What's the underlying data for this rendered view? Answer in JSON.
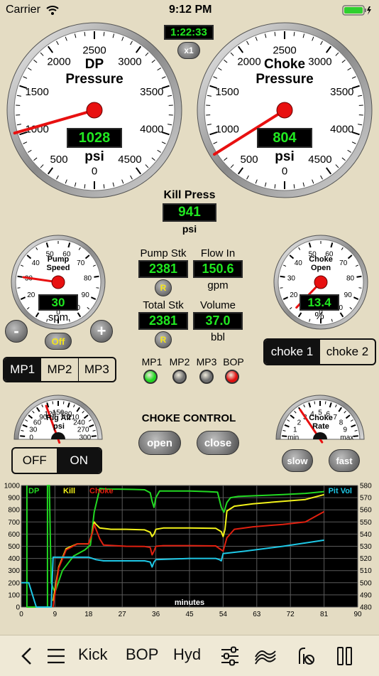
{
  "status_bar": {
    "carrier": "Carrier",
    "time": "9:12 PM"
  },
  "timer": {
    "elapsed": "1:22:33",
    "speed": "x1"
  },
  "gauges": {
    "dp": {
      "title_line1": "DP",
      "title_line2": "Pressure",
      "value": "1028",
      "unit": "psi",
      "ticks": [
        "0",
        "500",
        "1000",
        "1500",
        "2000",
        "2500",
        "3000",
        "3500",
        "4000",
        "4500"
      ],
      "needle_value": 1028,
      "max": 5000
    },
    "choke": {
      "title_line1": "Choke",
      "title_line2": "Pressure",
      "value": "804",
      "unit": "psi",
      "ticks": [
        "0",
        "500",
        "1000",
        "1500",
        "2000",
        "2500",
        "3000",
        "3500",
        "4000",
        "4500"
      ],
      "needle_value": 804,
      "max": 5000
    },
    "pump_speed": {
      "title_line1": "Pump",
      "title_line2": "Speed",
      "value": "30",
      "unit": "spm",
      "ticks": [
        "0",
        "10",
        "20",
        "30",
        "40",
        "50",
        "60",
        "70",
        "80",
        "90",
        "100"
      ],
      "needle_value": 30,
      "max": 110
    },
    "choke_open": {
      "title_line1": "Choke",
      "title_line2": "Open",
      "value": "13.4",
      "unit": "%",
      "ticks": [
        "0",
        "10",
        "20",
        "30",
        "40",
        "50",
        "60",
        "70",
        "80",
        "90",
        "100"
      ],
      "needle_value": 13.4,
      "max": 110
    },
    "rig_air": {
      "title_line1": "Rig Air",
      "title_line2": "psi",
      "ticks": [
        "0",
        "30",
        "60",
        "90",
        "120",
        "150",
        "180",
        "210",
        "240",
        "270",
        "300"
      ],
      "needle_value": 115,
      "max": 300
    },
    "choke_rate": {
      "title_line1": "Choke",
      "title_line2": "Rate",
      "ticks": [
        "min",
        "1",
        "2",
        "3",
        "4",
        "5",
        "6",
        "7",
        "8",
        "9",
        "max"
      ],
      "needle_value": 3,
      "max": 10
    }
  },
  "kill_press": {
    "label": "Kill Press",
    "value": "941",
    "unit": "psi"
  },
  "pump_stk": {
    "label": "Pump Stk",
    "value": "2381",
    "reset": "R"
  },
  "flow_in": {
    "label": "Flow In",
    "value": "150.6",
    "unit": "gpm"
  },
  "total_stk": {
    "label": "Total Stk",
    "value": "2381",
    "reset": "R"
  },
  "volume": {
    "label": "Volume",
    "value": "37.0",
    "unit": "bbl"
  },
  "pump_controls": {
    "minus": "-",
    "plus": "+",
    "off": "Off"
  },
  "pump_select": {
    "items": [
      "MP1",
      "MP2",
      "MP3"
    ],
    "selected": "MP1"
  },
  "choke_select": {
    "items": [
      "choke 1",
      "choke 2"
    ],
    "selected": "choke 1"
  },
  "indicators": [
    {
      "label": "MP1",
      "color": "#22d822"
    },
    {
      "label": "MP2",
      "color": "#707070"
    },
    {
      "label": "MP3",
      "color": "#707070"
    },
    {
      "label": "BOP",
      "color": "#e01010"
    }
  ],
  "choke_control": {
    "title": "CHOKE CONTROL",
    "open": "open",
    "close": "close",
    "slow": "slow",
    "fast": "fast"
  },
  "air_toggle": {
    "items": [
      "OFF",
      "ON"
    ],
    "selected": "ON"
  },
  "toolbar": {
    "kick": "Kick",
    "bop": "BOP",
    "hyd": "Hyd"
  },
  "chart_data": {
    "type": "line",
    "xlabel": "minutes",
    "x_ticks": [
      0,
      9,
      18,
      27,
      36,
      45,
      54,
      63,
      72,
      81,
      90
    ],
    "y_left_ticks": [
      0,
      100,
      200,
      300,
      400,
      500,
      600,
      700,
      800,
      900,
      1000
    ],
    "y_right_ticks": [
      480,
      490,
      500,
      510,
      520,
      530,
      540,
      550,
      560,
      570,
      580
    ],
    "xlim": [
      0,
      90
    ],
    "ylim_left": [
      0,
      1000
    ],
    "ylim_right": [
      480,
      580
    ],
    "grid": true,
    "series": [
      {
        "name": "DP",
        "color": "#22d822",
        "axis": "left",
        "points": [
          [
            1.5,
            1000
          ],
          [
            1.5,
            0
          ],
          [
            7,
            0
          ],
          [
            7,
            1000
          ],
          [
            7.5,
            1000
          ],
          [
            8,
            200
          ],
          [
            9,
            120
          ],
          [
            11,
            300
          ],
          [
            14,
            420
          ],
          [
            17,
            470
          ],
          [
            18.5,
            510
          ],
          [
            19.5,
            780
          ],
          [
            21,
            975
          ],
          [
            23,
            970
          ],
          [
            26,
            970
          ],
          [
            30,
            968
          ],
          [
            33,
            965
          ],
          [
            34.5,
            940
          ],
          [
            35,
            870
          ],
          [
            35.5,
            820
          ],
          [
            36,
            900
          ],
          [
            37,
            955
          ],
          [
            40,
            955
          ],
          [
            45,
            955
          ],
          [
            50,
            950
          ],
          [
            52.5,
            945
          ],
          [
            53.5,
            820
          ],
          [
            54.2,
            780
          ],
          [
            55,
            860
          ],
          [
            56,
            900
          ],
          [
            58,
            910
          ],
          [
            62,
            915
          ],
          [
            70,
            925
          ],
          [
            76,
            935
          ],
          [
            81,
            950
          ]
        ]
      },
      {
        "name": "Kill",
        "color": "#f2f21a",
        "axis": "left",
        "points": [
          [
            8.5,
            50
          ],
          [
            10,
            330
          ],
          [
            12,
            480
          ],
          [
            15,
            520
          ],
          [
            18,
            520
          ],
          [
            19,
            610
          ],
          [
            19.5,
            700
          ],
          [
            20,
            680
          ],
          [
            21,
            650
          ],
          [
            24,
            640
          ],
          [
            28,
            640
          ],
          [
            33,
            635
          ],
          [
            34.5,
            615
          ],
          [
            35,
            580
          ],
          [
            35.5,
            600
          ],
          [
            36,
            640
          ],
          [
            38,
            650
          ],
          [
            45,
            650
          ],
          [
            52,
            648
          ],
          [
            53.5,
            620
          ],
          [
            54,
            580
          ],
          [
            54.5,
            640
          ],
          [
            55,
            790
          ],
          [
            57,
            830
          ],
          [
            62,
            850
          ],
          [
            70,
            870
          ],
          [
            76,
            885
          ],
          [
            81,
            925
          ]
        ]
      },
      {
        "name": "Choke",
        "color": "#e02010",
        "axis": "left",
        "points": [
          [
            8.5,
            0
          ],
          [
            10,
            320
          ],
          [
            12,
            470
          ],
          [
            15,
            520
          ],
          [
            18,
            520
          ],
          [
            19,
            610
          ],
          [
            19.5,
            680
          ],
          [
            20,
            640
          ],
          [
            21,
            560
          ],
          [
            22,
            510
          ],
          [
            28,
            500
          ],
          [
            33,
            498
          ],
          [
            34.5,
            490
          ],
          [
            35,
            430
          ],
          [
            35.5,
            460
          ],
          [
            36,
            500
          ],
          [
            38,
            505
          ],
          [
            45,
            505
          ],
          [
            52,
            503
          ],
          [
            53.5,
            470
          ],
          [
            54,
            460
          ],
          [
            55,
            570
          ],
          [
            57,
            640
          ],
          [
            62,
            660
          ],
          [
            70,
            680
          ],
          [
            76,
            700
          ],
          [
            81,
            785
          ]
        ]
      },
      {
        "name": "Pit Vol",
        "color": "#1ec8e6",
        "axis": "right",
        "points": [
          [
            0,
            500
          ],
          [
            2,
            500
          ],
          [
            4,
            480
          ],
          [
            8,
            480
          ],
          [
            8.5,
            521
          ],
          [
            12,
            521
          ],
          [
            18,
            521
          ],
          [
            19,
            520
          ],
          [
            20,
            519
          ],
          [
            22,
            518
          ],
          [
            28,
            518
          ],
          [
            33,
            518
          ],
          [
            34.5,
            517
          ],
          [
            35,
            513
          ],
          [
            35.5,
            517
          ],
          [
            36,
            519
          ],
          [
            45,
            520
          ],
          [
            52,
            520
          ],
          [
            53,
            519
          ],
          [
            53.5,
            518
          ],
          [
            54,
            524
          ],
          [
            60,
            526
          ],
          [
            70,
            530
          ],
          [
            81,
            535
          ]
        ]
      }
    ]
  },
  "colors": {
    "background": "#e4dcc3",
    "lcd_text": "#20e820",
    "needle": "#e81010"
  },
  "icons": [
    "wifi-icon",
    "battery-icon",
    "back-chevron-icon",
    "menu-lines-icon",
    "sliders-icon",
    "waves-icon",
    "well-off-icon",
    "pause-icon"
  ]
}
